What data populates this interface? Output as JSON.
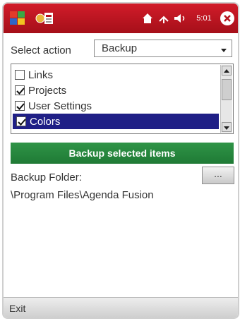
{
  "titlebar": {
    "time": "5:01"
  },
  "action": {
    "label": "Select action",
    "selected": "Backup"
  },
  "items": [
    {
      "label": "Links",
      "checked": false,
      "selected": false
    },
    {
      "label": "Projects",
      "checked": true,
      "selected": false
    },
    {
      "label": "User Settings",
      "checked": true,
      "selected": false
    },
    {
      "label": "Colors",
      "checked": true,
      "selected": true
    }
  ],
  "backup_button": "Backup selected items",
  "folder": {
    "label": "Backup Folder:",
    "browse": "...",
    "path": "\\Program Files\\Agenda Fusion"
  },
  "softkeys": {
    "left": "Exit"
  },
  "colors": {
    "titlebar": "#b7141f",
    "button": "#268441",
    "selection": "#1f1f86"
  }
}
